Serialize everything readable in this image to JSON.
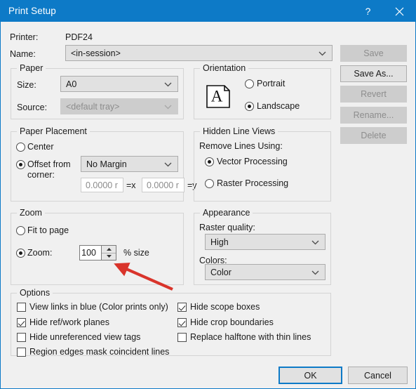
{
  "window": {
    "title": "Print Setup",
    "help_icon": "question-mark-icon",
    "close_icon": "close-icon",
    "titlebar_color": "#0d7ac7",
    "background_color": "#f0f0f0"
  },
  "printer": {
    "printer_label": "Printer:",
    "printer_value": "PDF24",
    "name_label": "Name:",
    "name_value": "<in-session>"
  },
  "profile_buttons": [
    {
      "label": "Save",
      "enabled": false
    },
    {
      "label": "Save As...",
      "enabled": true
    },
    {
      "label": "Revert",
      "enabled": false
    },
    {
      "label": "Rename...",
      "enabled": false
    },
    {
      "label": "Delete",
      "enabled": false
    }
  ],
  "paper": {
    "caption": "Paper",
    "size_label": "Size:",
    "size_value": "A0",
    "source_label": "Source:",
    "source_value": "<default tray>",
    "source_enabled": false
  },
  "orientation": {
    "caption": "Orientation",
    "icon": "page-letter-a-icon",
    "icon_letter": "A",
    "portrait_label": "Portrait",
    "landscape_label": "Landscape",
    "selected": "Landscape"
  },
  "paper_placement": {
    "caption": "Paper Placement",
    "center_label": "Center",
    "offset_label_line1": "Offset from",
    "offset_label_line2": "corner:",
    "selected": "Offset from corner",
    "margin_value": "No Margin",
    "x_value": "0.0000 r",
    "x_suffix": "=x",
    "y_value": "0.0000 r",
    "y_suffix": "=y"
  },
  "hidden_line_views": {
    "caption": "Hidden Line Views",
    "remove_label": "Remove Lines Using:",
    "vector_label": "Vector Processing",
    "raster_label": "Raster Processing",
    "selected": "Vector Processing"
  },
  "zoom": {
    "caption": "Zoom",
    "fit_label": "Fit to page",
    "zoom_label": "Zoom:",
    "selected": "Zoom",
    "zoom_value": "100",
    "percent_label": "% size"
  },
  "appearance": {
    "caption": "Appearance",
    "raster_quality_label": "Raster quality:",
    "raster_quality_value": "High",
    "colors_label": "Colors:",
    "colors_value": "Color"
  },
  "options": {
    "caption": "Options",
    "left": [
      {
        "label": "View links in blue (Color prints only)",
        "checked": false
      },
      {
        "label": "Hide ref/work planes",
        "checked": true
      },
      {
        "label": "Hide unreferenced view tags",
        "checked": false
      },
      {
        "label": "Region edges mask coincident lines",
        "checked": false
      }
    ],
    "right": [
      {
        "label": "Hide scope boxes",
        "checked": true
      },
      {
        "label": "Hide crop boundaries",
        "checked": true
      },
      {
        "label": "Replace halftone with thin lines",
        "checked": false
      }
    ]
  },
  "footer": {
    "ok_label": "OK",
    "cancel_label": "Cancel"
  },
  "annotation": {
    "type": "arrow",
    "color": "#d9342b",
    "points_to": "zoom-percent-spinner"
  }
}
